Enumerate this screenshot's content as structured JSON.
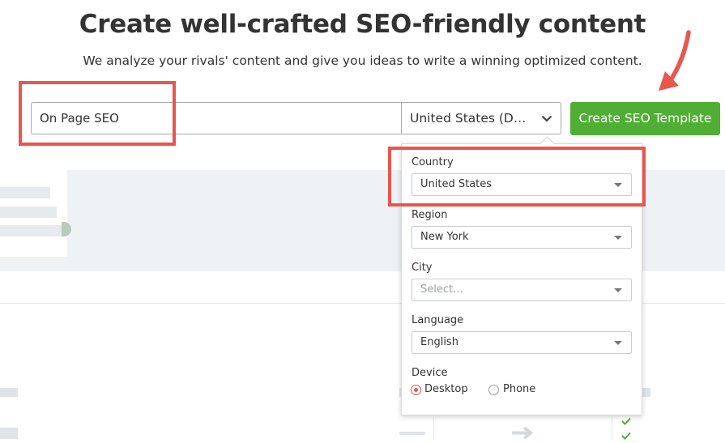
{
  "header": {
    "title": "Create well-crafted SEO-friendly content",
    "subtitle": "We analyze your rivals' content and give you ideas to write a winning optimized content."
  },
  "search": {
    "keyword_value": "On Page SEO",
    "location_value": "United States (Desktop)",
    "submit_label": "Create SEO Template"
  },
  "location_panel": {
    "country": {
      "label": "Country",
      "value": "United States"
    },
    "region": {
      "label": "Region",
      "value": "New York"
    },
    "city": {
      "label": "City",
      "placeholder": "Select..."
    },
    "language": {
      "label": "Language",
      "value": "English"
    },
    "device": {
      "label": "Device",
      "options": [
        "Desktop",
        "Phone"
      ],
      "selected": "Desktop"
    }
  },
  "colors": {
    "accent_green": "#4fae33",
    "annotation_red": "#e8564d",
    "band_gray": "#eef2f5"
  },
  "icons": {
    "location_chevron": "chevron-down-icon",
    "select_arrow": "caret-down-icon",
    "annotation_arrow": "red-arrow-icon"
  }
}
